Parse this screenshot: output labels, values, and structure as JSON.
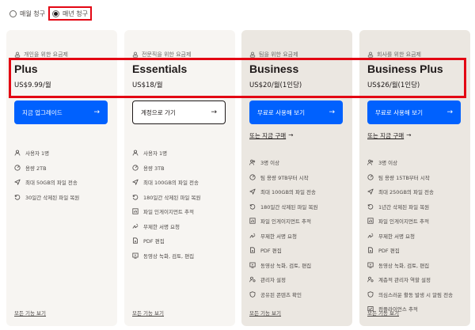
{
  "billing": {
    "options": [
      {
        "label": "매월 청구",
        "selected": false
      },
      {
        "label": "매년 청구",
        "selected": true
      }
    ]
  },
  "plans": [
    {
      "audience": "개인을 위한 요금제",
      "name": "Plus",
      "price": "US$9.99/월",
      "button": "지금 업그레이드",
      "button_style": "primary",
      "trial": "",
      "features": [
        {
          "icon": "user-icon",
          "text": "사용자 1명"
        },
        {
          "icon": "storage-icon",
          "text": "용량 2TB"
        },
        {
          "icon": "send-icon",
          "text": "최대 50GB의 파일 전송"
        },
        {
          "icon": "restore-icon",
          "text": "30일간 삭제된 파일 복원"
        }
      ],
      "see_all": "모든 기능 보기"
    },
    {
      "audience": "전문직을 위한 요금제",
      "name": "Essentials",
      "price": "US$18/월",
      "button": "계정으로 가기",
      "button_style": "outline",
      "trial": "",
      "features": [
        {
          "icon": "user-icon",
          "text": "사용자 1명"
        },
        {
          "icon": "storage-icon",
          "text": "용량 3TB"
        },
        {
          "icon": "send-icon",
          "text": "최대 100GB의 파일 전송"
        },
        {
          "icon": "restore-icon",
          "text": "180일간 삭제된 파일 복원"
        },
        {
          "icon": "chart-icon",
          "text": "파일 인게이지먼트 추적"
        },
        {
          "icon": "signature-icon",
          "text": "무제한 서명 요청"
        },
        {
          "icon": "pdf-icon",
          "text": "PDF 편집"
        },
        {
          "icon": "video-icon",
          "text": "동영상 녹화, 검토, 편집"
        }
      ],
      "see_all": "모든 기능 보기"
    },
    {
      "audience": "팀을 위한 요금제",
      "name": "Business",
      "price": "US$20/월(1인당)",
      "button": "무료로 사용해 보기",
      "button_style": "primary",
      "trial": "또는 지금 구매",
      "features": [
        {
          "icon": "users-icon",
          "text": "3명 이상"
        },
        {
          "icon": "storage-icon",
          "text": "팀 용량 9TB부터 시작"
        },
        {
          "icon": "send-icon",
          "text": "최대 100GB의 파일 전송"
        },
        {
          "icon": "restore-icon",
          "text": "180일간 삭제된 파일 복원"
        },
        {
          "icon": "chart-icon",
          "text": "파일 인게이지먼트 추적"
        },
        {
          "icon": "signature-icon",
          "text": "무제한 서명 요청"
        },
        {
          "icon": "pdf-icon",
          "text": "PDF 편집"
        },
        {
          "icon": "video-icon",
          "text": "동영상 녹화, 검토, 편집"
        },
        {
          "icon": "admin-icon",
          "text": "관리자 설정"
        },
        {
          "icon": "shield-icon",
          "text": "공유된 콘텐츠 확인"
        }
      ],
      "see_all": "모든 기능 보기"
    },
    {
      "audience": "회사를 위한 요금제",
      "name": "Business Plus",
      "price": "US$26/월(1인당)",
      "button": "무료로 사용해 보기",
      "button_style": "primary",
      "trial": "또는 지금 구매",
      "features": [
        {
          "icon": "users-icon",
          "text": "3명 이상"
        },
        {
          "icon": "storage-icon",
          "text": "팀 용량 15TB부터 시작"
        },
        {
          "icon": "send-icon",
          "text": "최대 250GB의 파일 전송"
        },
        {
          "icon": "restore-icon",
          "text": "1년간 삭제된 파일 복원"
        },
        {
          "icon": "chart-icon",
          "text": "파일 인게이지먼트 추적"
        },
        {
          "icon": "signature-icon",
          "text": "무제한 서명 요청"
        },
        {
          "icon": "pdf-icon",
          "text": "PDF 편집"
        },
        {
          "icon": "video-icon",
          "text": "동영상 녹화, 검토, 편집"
        },
        {
          "icon": "admin-icon",
          "text": "계층적 관리자 역할 설정"
        },
        {
          "icon": "shield-icon",
          "text": "의심스러운 활동 발생 시 알림 전송"
        },
        {
          "icon": "compliance-icon",
          "text": "컴플라이언스 추적"
        }
      ],
      "see_all": "모든 기능 보기"
    }
  ],
  "colors": {
    "accent": "#0061fe",
    "highlight_box": "#e30613",
    "card_bg": "#f7f5f2",
    "business_card_bg": "#ebe7e1"
  }
}
